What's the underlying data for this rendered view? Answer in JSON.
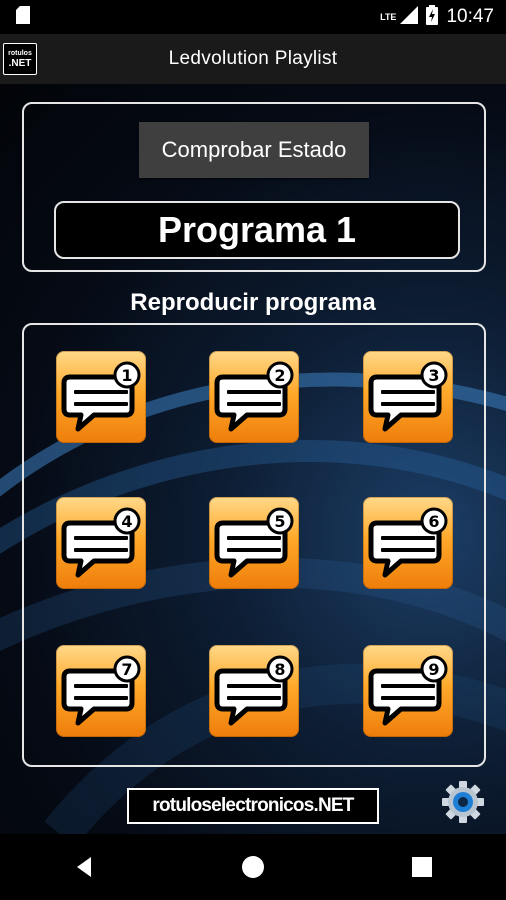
{
  "status_bar": {
    "network": "LTE",
    "time": "10:47",
    "icons": [
      "sd-card-icon",
      "signal-icon",
      "battery-charging-icon"
    ]
  },
  "app_bar": {
    "logo_line1": "rotulos",
    "logo_line2": ".NET",
    "title": "Ledvolution Playlist"
  },
  "main": {
    "check_status_label": "Comprobar Estado",
    "current_program": "Programa 1",
    "section_title": "Reproducir programa",
    "programs": [
      {
        "number": "1"
      },
      {
        "number": "2"
      },
      {
        "number": "3"
      },
      {
        "number": "4"
      },
      {
        "number": "5"
      },
      {
        "number": "6"
      },
      {
        "number": "7"
      },
      {
        "number": "8"
      },
      {
        "number": "9"
      }
    ],
    "footer_logo": "rotuloselectronicos.NET",
    "settings_icon": "gear-icon"
  },
  "nav_bar": {
    "buttons": [
      "back-icon",
      "home-icon",
      "recents-icon"
    ]
  },
  "colors": {
    "button_orange_light": "#ffd98a",
    "button_orange": "#ffa92a",
    "button_orange_dark": "#ee7d0a",
    "panel_border": "#e6e6e6",
    "app_bar": "#1a1a1a",
    "check_button": "#3f3f3f"
  }
}
